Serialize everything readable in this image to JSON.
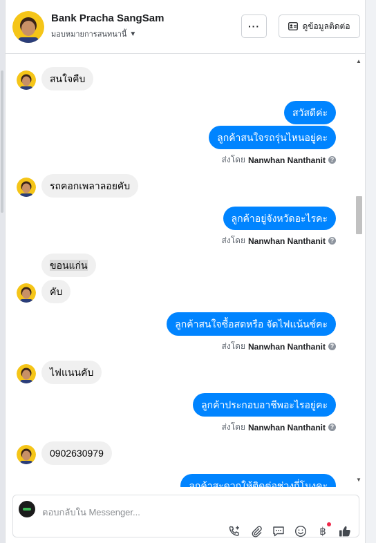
{
  "header": {
    "name": "Bank Pracha SangSam",
    "assign_label": "มอบหมายการสนทนานี้",
    "more_label": "···",
    "contact_button": "ดูข้อมูลติดต่อ"
  },
  "messages": [
    {
      "dir": "in",
      "text": "สนใจคืบ"
    },
    {
      "dir": "out",
      "text": "สวัสดีค่ะ"
    },
    {
      "dir": "out",
      "text": "ลูกค้าสนใจรถรุ่นไหนอยู่คะ"
    },
    {
      "dir": "in",
      "text": "รถคอกเพลาลอยคับ"
    },
    {
      "dir": "out",
      "text": "ลูกค้าอยู่จังหวัดอะไรคะ"
    },
    {
      "dir": "in",
      "text": "ขอนแก่น"
    },
    {
      "dir": "in",
      "text": "คับ"
    },
    {
      "dir": "out",
      "text": "ลูกค้าสนใจซื้อสดหรือ จัดไฟแน้นซ์คะ"
    },
    {
      "dir": "in",
      "text": "ไฟแนนคับ"
    },
    {
      "dir": "out",
      "text": "ลูกค้าประกอบอาชีพอะไรอยู่คะ"
    },
    {
      "dir": "in",
      "text": "0902630979"
    },
    {
      "dir": "out",
      "text": "ลูกค้าสะดวกให้ติดต่อช่วงกี่โมงคะ"
    }
  ],
  "sent_by": {
    "prefix": "ส่งโดย",
    "agent": "Nanwhan Nanthanit"
  },
  "composer": {
    "placeholder": "ตอบกลับใน Messenger..."
  },
  "composer_tools": [
    "phone-plus-icon",
    "attachment-icon",
    "saved-reply-icon",
    "emoji-icon",
    "baht-icon",
    "like-icon"
  ],
  "colors": {
    "outgoing_bubble": "#0084ff",
    "incoming_bubble": "#f0f0f0",
    "avatar_bg": "#f5c518"
  }
}
